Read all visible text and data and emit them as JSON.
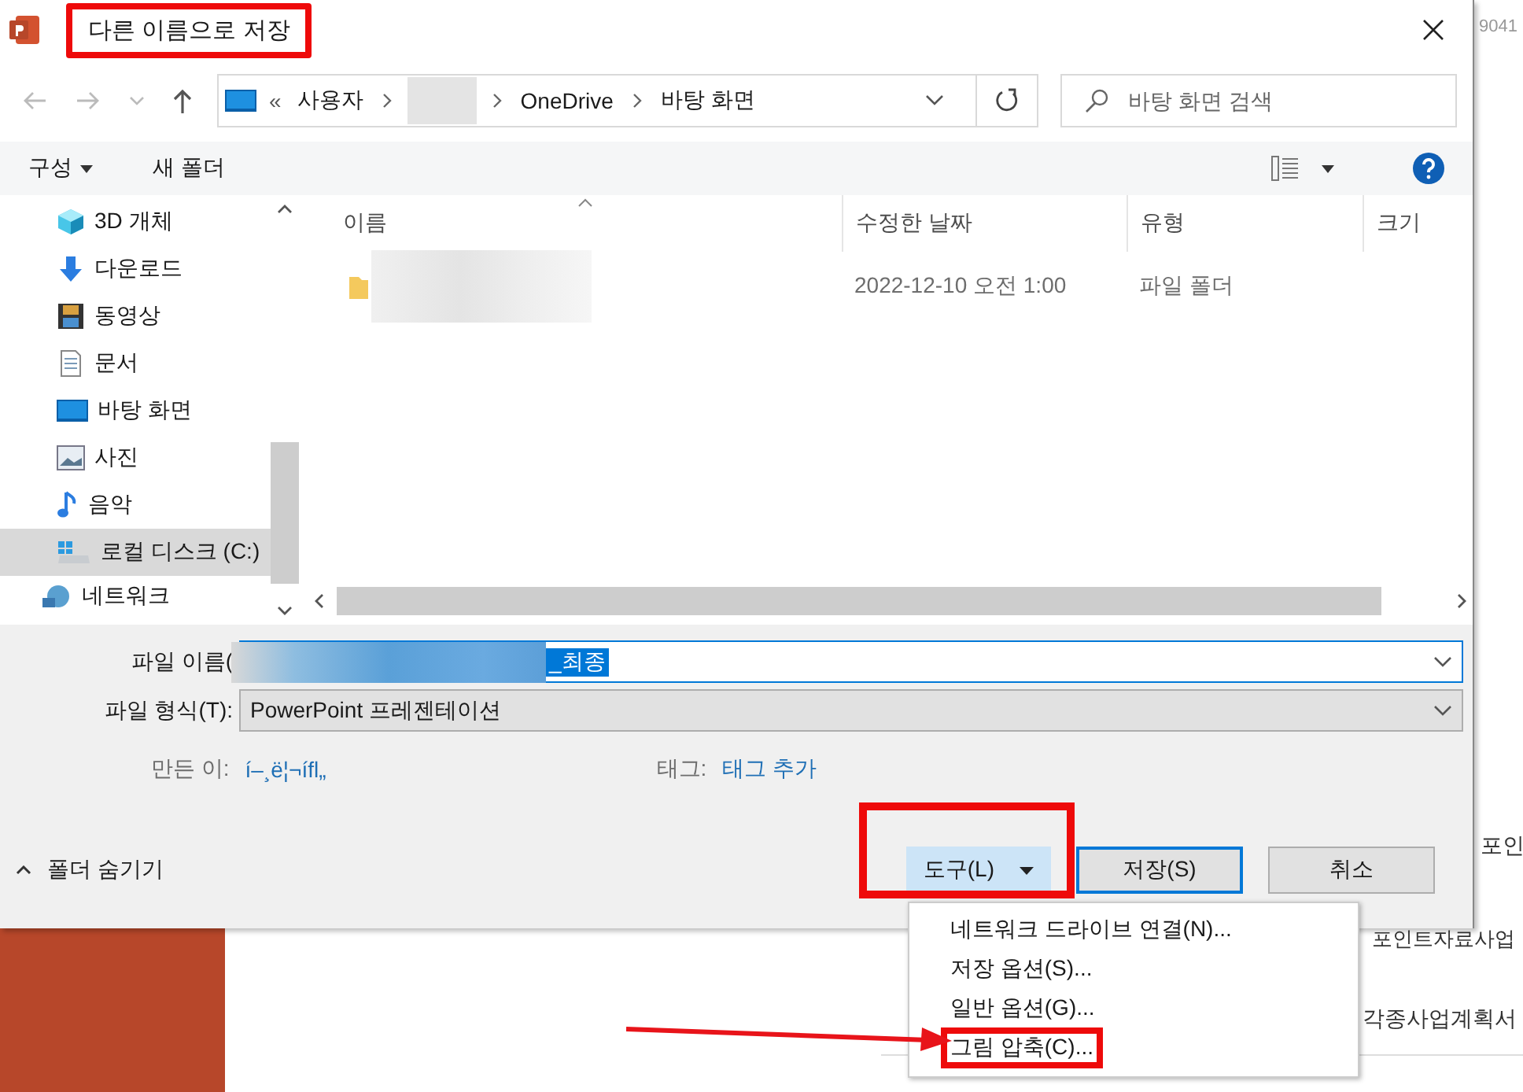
{
  "background": {
    "texts": [
      {
        "label": "9041",
        "kind": "top"
      },
      {
        "label": "포인",
        "kind": "mid"
      },
      {
        "label": "포인트자료사업",
        "kind": "low"
      },
      {
        "label": "각종사업계획서",
        "kind": "bottom"
      }
    ]
  },
  "window": {
    "title": "다른 이름으로 저장",
    "annotated": true
  },
  "breadcrumb": {
    "overflow": "«",
    "parts": [
      {
        "kind": "text",
        "label": "사용자"
      },
      {
        "kind": "redacted"
      },
      {
        "kind": "text",
        "label": "OneDrive"
      },
      {
        "kind": "text",
        "label": "바탕 화면"
      }
    ]
  },
  "search": {
    "placeholder": "바탕 화면 검색"
  },
  "toolbar": {
    "organize": "구성",
    "new_folder": "새 폴더"
  },
  "nav_items": [
    {
      "label": "3D 개체",
      "kind": "cube",
      "selected": false
    },
    {
      "label": "다운로드",
      "kind": "download",
      "selected": false
    },
    {
      "label": "동영상",
      "kind": "video",
      "selected": false
    },
    {
      "label": "문서",
      "kind": "document",
      "selected": false
    },
    {
      "label": "바탕 화면",
      "kind": "desktop",
      "selected": false
    },
    {
      "label": "사진",
      "kind": "picture",
      "selected": false
    },
    {
      "label": "음악",
      "kind": "music",
      "selected": false
    },
    {
      "label": "로컬 디스크 (C:)",
      "kind": "drive",
      "selected": true
    },
    {
      "label": "네트워크",
      "kind": "network",
      "selected": false
    }
  ],
  "columns": [
    {
      "label": "이름",
      "sorted": true
    },
    {
      "label": "수정한 날짜",
      "sorted": false
    },
    {
      "label": "유형",
      "sorted": false
    },
    {
      "label": "크기",
      "sorted": false
    }
  ],
  "rows": [
    {
      "kind": "folder",
      "modified": "2022-12-10 오전 1:00",
      "type": "파일 폴더"
    }
  ],
  "form": {
    "filename_label": "파일 이름(",
    "filename_value": "_최종",
    "filetype_label": "파일 형식(T):",
    "filetype_value": "PowerPoint 프레젠테이션",
    "author_label": "만든 이:",
    "author_value": "í–¸ë¦¬ífl„",
    "tags_label": "태그:",
    "tags_value": "태그 추가"
  },
  "footer": {
    "hide_folders": "폴더 숨기기",
    "buttons": [
      {
        "label": "도구(L)",
        "kind": "menu",
        "annotated": true
      },
      {
        "label": "저장(S)",
        "kind": "default",
        "annotated": false
      },
      {
        "label": "취소",
        "kind": "normal",
        "annotated": false
      }
    ]
  },
  "tools_menu": {
    "items": [
      {
        "label": "네트워크 드라이브 연결(N)...",
        "annotated": false
      },
      {
        "label": "저장 옵션(S)...",
        "annotated": false
      },
      {
        "label": "일반 옵션(G)...",
        "annotated": false
      },
      {
        "label": "그림 압축(C)...",
        "annotated": true
      }
    ]
  }
}
